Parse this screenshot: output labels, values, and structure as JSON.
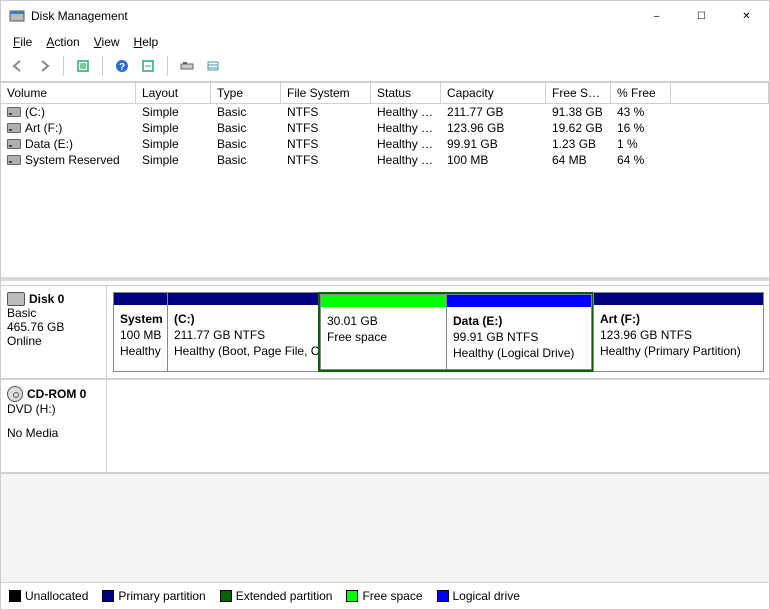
{
  "window": {
    "title": "Disk Management"
  },
  "menu": {
    "file": "File",
    "action": "Action",
    "view": "View",
    "help": "Help"
  },
  "columns": [
    "Volume",
    "Layout",
    "Type",
    "File System",
    "Status",
    "Capacity",
    "Free Spa...",
    "% Free"
  ],
  "volumes": [
    {
      "name": "(C:)",
      "layout": "Simple",
      "type": "Basic",
      "fs": "NTFS",
      "status": "Healthy (B...",
      "capacity": "211.77 GB",
      "free": "91.38 GB",
      "pct": "43 %"
    },
    {
      "name": "Art (F:)",
      "layout": "Simple",
      "type": "Basic",
      "fs": "NTFS",
      "status": "Healthy (P...",
      "capacity": "123.96 GB",
      "free": "19.62 GB",
      "pct": "16 %"
    },
    {
      "name": "Data (E:)",
      "layout": "Simple",
      "type": "Basic",
      "fs": "NTFS",
      "status": "Healthy (L...",
      "capacity": "99.91 GB",
      "free": "1.23 GB",
      "pct": "1 %"
    },
    {
      "name": "System Reserved",
      "layout": "Simple",
      "type": "Basic",
      "fs": "NTFS",
      "status": "Healthy (S...",
      "capacity": "100 MB",
      "free": "64 MB",
      "pct": "64 %"
    }
  ],
  "disk0": {
    "name": "Disk 0",
    "type": "Basic",
    "size": "465.76 GB",
    "state": "Online",
    "parts": {
      "sys": {
        "title": "System",
        "l2": "100 MB",
        "l3": "Healthy"
      },
      "c": {
        "title": "(C:)",
        "l2": "211.77 GB NTFS",
        "l3": "Healthy (Boot, Page File, Crash Dump, Primary Partition)"
      },
      "free": {
        "title": "",
        "l2": "30.01 GB",
        "l3": "Free space"
      },
      "data": {
        "title": "Data  (E:)",
        "l2": "99.91 GB NTFS",
        "l3": "Healthy (Logical Drive)"
      },
      "art": {
        "title": "Art  (F:)",
        "l2": "123.96 GB NTFS",
        "l3": "Healthy (Primary Partition)"
      }
    }
  },
  "cdrom": {
    "name": "CD-ROM 0",
    "type": "DVD (H:)",
    "state": "No Media"
  },
  "legend": {
    "unalloc": "Unallocated",
    "primary": "Primary partition",
    "extended": "Extended partition",
    "free": "Free space",
    "logical": "Logical drive"
  }
}
